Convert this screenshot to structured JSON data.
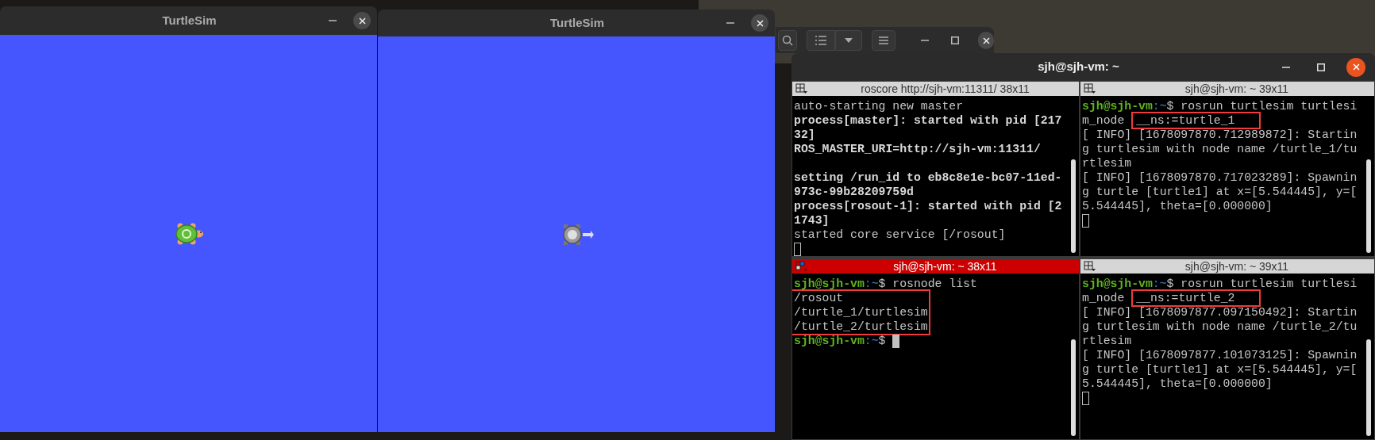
{
  "turtle_windows": [
    {
      "title": "TurtleSim",
      "kind": "green"
    },
    {
      "title": "TurtleSim",
      "kind": "grey"
    }
  ],
  "terminal": {
    "title": "sjh@sjh-vm: ~",
    "panes": [
      {
        "title": "roscore http://sjh-vm:11311/ 38x11",
        "active": false,
        "lines": [
          {
            "kind": "text",
            "text": "auto-starting new master",
            "bold": false
          },
          {
            "kind": "text",
            "text": "process[master]: started with pid [217",
            "bold": true
          },
          {
            "kind": "text",
            "text": "32]",
            "bold": true
          },
          {
            "kind": "text",
            "text": "ROS_MASTER_URI=http://sjh-vm:11311/",
            "bold": true
          },
          {
            "kind": "blank"
          },
          {
            "kind": "text",
            "text": "setting /run_id to eb8c8e1e-bc07-11ed-",
            "bold": true
          },
          {
            "kind": "text",
            "text": "973c-99b28209759d",
            "bold": true
          },
          {
            "kind": "text",
            "text": "process[rosout-1]: started with pid [2",
            "bold": true
          },
          {
            "kind": "text",
            "text": "1743]",
            "bold": true
          },
          {
            "kind": "text",
            "text": "started core service [/rosout]",
            "bold": false
          },
          {
            "kind": "cursor"
          }
        ]
      },
      {
        "title": "sjh@sjh-vm: ~ 39x11",
        "active": false,
        "lines": [
          {
            "kind": "prompt",
            "user": "sjh@sjh-vm",
            "path": ":~",
            "command": "$ rosrun turtlesim turtlesi",
            "cursor": false
          },
          {
            "kind": "marked",
            "before": "m_node ",
            "marked": "__ns:=turtle_1"
          },
          {
            "kind": "text",
            "text": "[ INFO] [1678097870.712989872]: Startin",
            "bold": false
          },
          {
            "kind": "text",
            "text": "g turtlesim with node name /turtle_1/tu",
            "bold": false
          },
          {
            "kind": "text",
            "text": "rtlesim",
            "bold": false
          },
          {
            "kind": "text",
            "text": "[ INFO] [1678097870.717023289]: Spawnin",
            "bold": false
          },
          {
            "kind": "text",
            "text": "g turtle [turtle1] at x=[5.544445], y=[",
            "bold": false
          },
          {
            "kind": "text",
            "text": "5.544445], theta=[0.000000]",
            "bold": false
          },
          {
            "kind": "cursor"
          }
        ]
      },
      {
        "title": "sjh@sjh-vm: ~ 38x11",
        "active": true,
        "lines": [
          {
            "kind": "prompt",
            "user": "sjh@sjh-vm",
            "path": ":~",
            "command": "$ rosnode list",
            "cursor": false
          },
          {
            "kind": "group",
            "lines": [
              {
                "kind": "text",
                "text": "/rosout",
                "bold": false
              },
              {
                "kind": "text",
                "text": "/turtle_1/turtlesim",
                "bold": false
              },
              {
                "kind": "text",
                "text": "/turtle_2/turtlesim",
                "bold": false
              }
            ]
          },
          {
            "kind": "prompt",
            "user": "sjh@sjh-vm",
            "path": ":~",
            "command": "$",
            "cursor": true
          }
        ]
      },
      {
        "title": "sjh@sjh-vm: ~ 39x11",
        "active": false,
        "lines": [
          {
            "kind": "prompt",
            "user": "sjh@sjh-vm",
            "path": ":~",
            "command": "$ rosrun turtlesim turtlesi",
            "cursor": false
          },
          {
            "kind": "marked",
            "before": "m_node ",
            "marked": "__ns:=turtle_2"
          },
          {
            "kind": "text",
            "text": "[ INFO] [1678097877.097150492]: Startin",
            "bold": false
          },
          {
            "kind": "text",
            "text": "g turtlesim with node name /turtle_2/tu",
            "bold": false
          },
          {
            "kind": "text",
            "text": "rtlesim",
            "bold": false
          },
          {
            "kind": "text",
            "text": "[ INFO] [1678097877.101073125]: Spawnin",
            "bold": false
          },
          {
            "kind": "text",
            "text": "g turtle [turtle1] at x=[5.544445], y=[",
            "bold": false
          },
          {
            "kind": "text",
            "text": "5.544445], theta=[0.000000]",
            "bold": false
          },
          {
            "kind": "cursor"
          }
        ]
      }
    ]
  }
}
